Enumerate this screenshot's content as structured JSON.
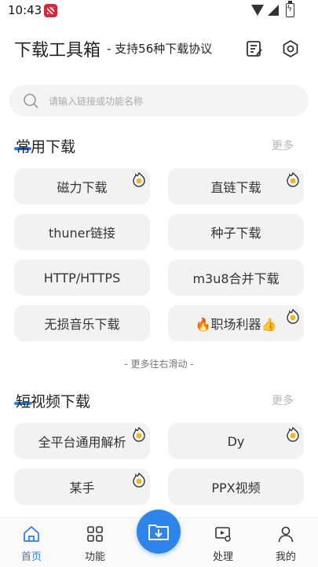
{
  "status": {
    "time": "10:43"
  },
  "header": {
    "title": "下载工具箱",
    "subtitle": "- 支持56种下载协议"
  },
  "search": {
    "placeholder": "请输入链接或功能名称"
  },
  "sections": [
    {
      "title": "常用下载",
      "more": "更多",
      "items": [
        {
          "label": "磁力下载",
          "hot": true
        },
        {
          "label": "直链下载",
          "hot": true
        },
        {
          "label": "thuner链接",
          "hot": false
        },
        {
          "label": "种子下载",
          "hot": false
        },
        {
          "label": "HTTP/HTTPS",
          "hot": false
        },
        {
          "label": "m3u8合并下载",
          "hot": false
        },
        {
          "label": "无损音乐下载",
          "hot": false
        },
        {
          "label": "🔥职场利器👍",
          "hot": true
        }
      ]
    },
    {
      "title": "短视频下载",
      "more": "更多",
      "items": [
        {
          "label": "全平台通用解析",
          "hot": true
        },
        {
          "label": "Dy",
          "hot": true
        },
        {
          "label": "某手",
          "hot": true
        },
        {
          "label": "PPX视频",
          "hot": false
        }
      ]
    }
  ],
  "swipe_hint": "- 更多往右滑动 -",
  "nav": {
    "items": [
      {
        "label": "首页",
        "icon": "home-icon",
        "active": true
      },
      {
        "label": "功能",
        "icon": "grid-icon",
        "active": false
      },
      {
        "label": "处理",
        "icon": "process-icon",
        "active": false
      },
      {
        "label": "我的",
        "icon": "person-icon",
        "active": false
      }
    ],
    "fab_icon": "download-folder-icon"
  },
  "colors": {
    "accent": "#2d84ea",
    "badge": "#f0a020",
    "tile": "#f2f2f2"
  }
}
